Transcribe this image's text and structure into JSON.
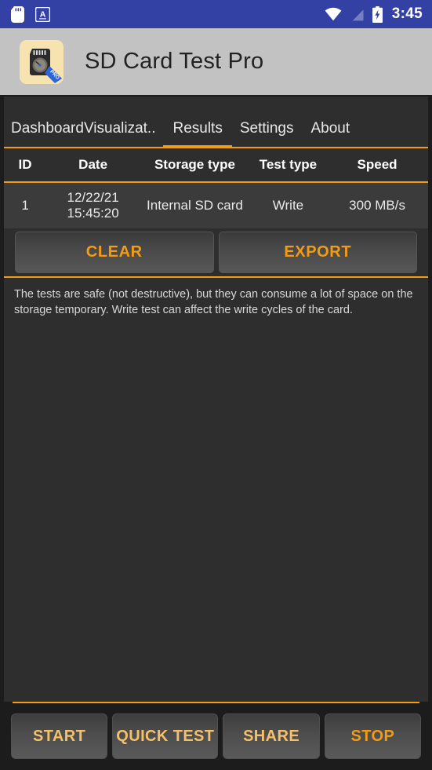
{
  "status_bar": {
    "icons": [
      "sd-card-icon",
      "keyboard-language-icon"
    ],
    "wifi_icon": "wifi-icon",
    "signal_icon": "no-signal-icon",
    "battery_icon": "battery-charging-icon",
    "time": "3:45",
    "background_color": "#3340a4"
  },
  "app_bar": {
    "icon": "sd-card-test-pro-app-icon",
    "title": "SD Card Test Pro",
    "background_color": "#c2c2c2"
  },
  "tabs": [
    {
      "label": "Dashboard",
      "active": false
    },
    {
      "label": "Visualizat..",
      "active": false
    },
    {
      "label": "Results",
      "active": true
    },
    {
      "label": "Settings",
      "active": false
    },
    {
      "label": "About",
      "active": false
    }
  ],
  "accent_color": "#f39c12",
  "table": {
    "headers": [
      "ID",
      "Date",
      "Storage type",
      "Test type",
      "Speed"
    ],
    "rows": [
      {
        "id": "1",
        "date": "12/22/21 15:45:20",
        "storage_type": "Internal SD card",
        "test_type": "Write",
        "speed": "300 MB/s"
      }
    ]
  },
  "actions": {
    "clear_label": "CLEAR",
    "export_label": "EXPORT"
  },
  "info_text": "The tests are safe (not destructive), but they can consume a lot of space on the storage temporary. Write test can affect the write cycles of the card.",
  "bottom_bar": {
    "buttons": [
      {
        "label": "START",
        "enabled": false
      },
      {
        "label": "QUICK TEST",
        "enabled": false
      },
      {
        "label": "SHARE",
        "enabled": false
      },
      {
        "label": "STOP",
        "enabled": true
      }
    ]
  }
}
